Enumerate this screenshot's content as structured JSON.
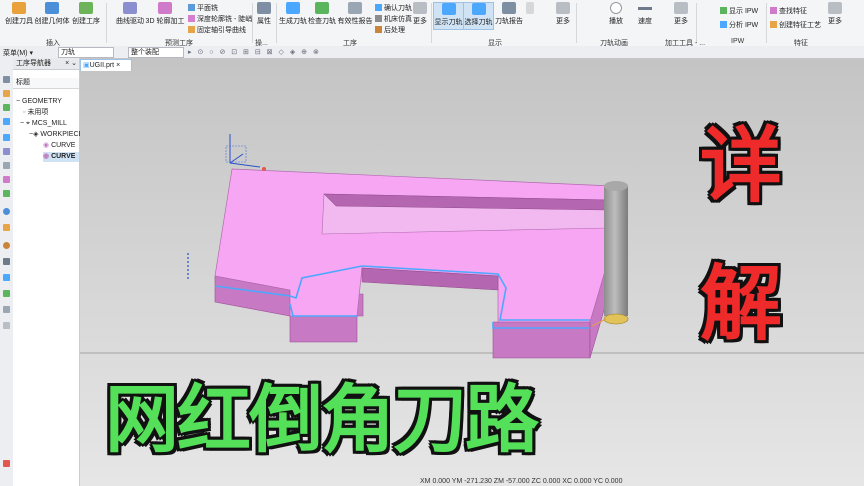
{
  "ribbon": {
    "buttons": [
      {
        "label": "创建刀具",
        "icon": "create-tool-icon"
      },
      {
        "label": "创建几何体",
        "icon": "create-geometry-icon"
      },
      {
        "label": "创建工序",
        "icon": "create-operation-icon"
      },
      {
        "label": "曲线驱动",
        "icon": "curve-drive-icon"
      },
      {
        "label": "3D 轮廓加工",
        "icon": "contour-3d-icon"
      },
      {
        "label": "属性",
        "icon": "properties-icon"
      },
      {
        "label": "生成刀轨",
        "icon": "generate-toolpath-icon"
      },
      {
        "label": "检查刀轨",
        "icon": "verify-toolpath-icon"
      },
      {
        "label": "有效性报告",
        "icon": "validity-report-icon"
      },
      {
        "label": "更多",
        "icon": "more-icon"
      },
      {
        "label": "显示刀轨",
        "icon": "show-toolpath-icon"
      },
      {
        "label": "选择刀轨",
        "icon": "select-toolpath-icon"
      },
      {
        "label": "刀轨报告",
        "icon": "toolpath-report-icon"
      },
      {
        "label": "更多",
        "icon": "more-icon"
      },
      {
        "label": "播放",
        "icon": "play-icon"
      },
      {
        "label": "速度",
        "icon": "speed-icon"
      },
      {
        "label": "更多",
        "icon": "more-icon"
      }
    ],
    "small_items": [
      "平面铣",
      "深度轮廓铣 - 陡峭",
      "固定轴引导曲线",
      "确认刀轨",
      "机床仿真",
      "后处理",
      "显示 IPW",
      "分析 IPW",
      "查找特征",
      "创建特征工艺"
    ],
    "groups": [
      "插入",
      "预测工序",
      "操...",
      "工序",
      "显示",
      "刀轨动画",
      "加工工具 - ...",
      "IPW",
      "特征"
    ]
  },
  "selection_bar": {
    "menu_label": "菜单(M) ▾",
    "filter_value": "刀轨",
    "scope_value": "整个装配"
  },
  "navigator": {
    "title": "工序导航器",
    "column": "标题",
    "nodes": [
      "GEOMETRY",
      "未用项",
      "MCS_MILL",
      "WORKPIECE",
      "CURVE",
      "CURVE"
    ]
  },
  "viewport": {
    "tab_label": "UGII.prt",
    "tab_close": "×"
  },
  "overlay": {
    "side_char_1": "详",
    "side_char_2": "解",
    "title": "网红倒角刀路"
  },
  "status_text": "XM 0.000 YM -271.230 ZM -57.000 ZC 0.000 XC 0.000 YC 0.000",
  "colors": {
    "part_top": "#f6a6f2",
    "part_side": "#c879c4",
    "toolpath": "#4ca8ff",
    "tool": "#9c9c9c",
    "overlay_red": "#ee2a2a",
    "overlay_green": "#55e05a"
  }
}
